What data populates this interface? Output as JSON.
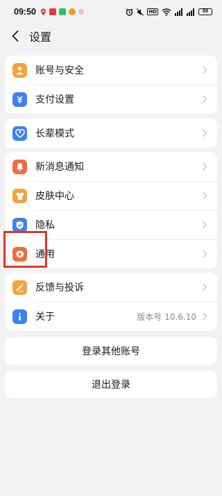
{
  "status_bar": {
    "time": "09:50",
    "hd_label": "HD",
    "battery": "69"
  },
  "header": {
    "title": "设置"
  },
  "groups": [
    {
      "items": [
        {
          "label": "账号与安全",
          "icon": "person-icon",
          "color": "#f5a33c"
        },
        {
          "label": "支付设置",
          "icon": "yuan-icon",
          "color": "#3c82f6"
        }
      ]
    },
    {
      "items": [
        {
          "label": "长辈模式",
          "icon": "heart-care-icon",
          "color": "#3c82f6"
        }
      ]
    },
    {
      "items": [
        {
          "label": "新消息通知",
          "icon": "bell-icon",
          "color": "#f26b3a"
        },
        {
          "label": "皮肤中心",
          "icon": "shirt-icon",
          "color": "#f5a33c"
        },
        {
          "label": "隐私",
          "icon": "shield-icon",
          "color": "#3c82f6"
        },
        {
          "label": "通用",
          "icon": "gear-icon",
          "color": "#f26b3a"
        }
      ]
    },
    {
      "items": [
        {
          "label": "反馈与投诉",
          "icon": "pencil-icon",
          "color": "#f5a33c"
        },
        {
          "label": "关于",
          "icon": "info-icon",
          "color": "#3c82f6",
          "value": "版本号 10.6.10"
        }
      ]
    }
  ],
  "actions": {
    "switch_account": "登录其他账号",
    "logout": "退出登录"
  },
  "colors": {
    "background": "#f2f2f2",
    "highlight": "#e6321e"
  }
}
